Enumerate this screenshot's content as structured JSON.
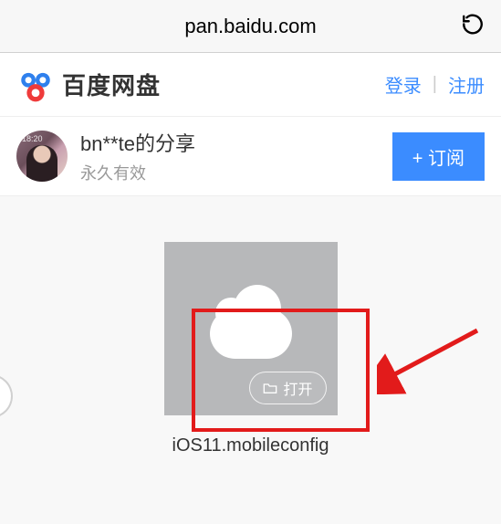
{
  "browser": {
    "url": "pan.baidu.com"
  },
  "header": {
    "brand": "百度网盘",
    "login": "登录",
    "register": "注册"
  },
  "share": {
    "title": "bn**te的分享",
    "validity": "永久有效",
    "subscribe": "+ 订阅"
  },
  "file": {
    "open_label": "打开",
    "name": "iOS11.mobileconfig"
  }
}
